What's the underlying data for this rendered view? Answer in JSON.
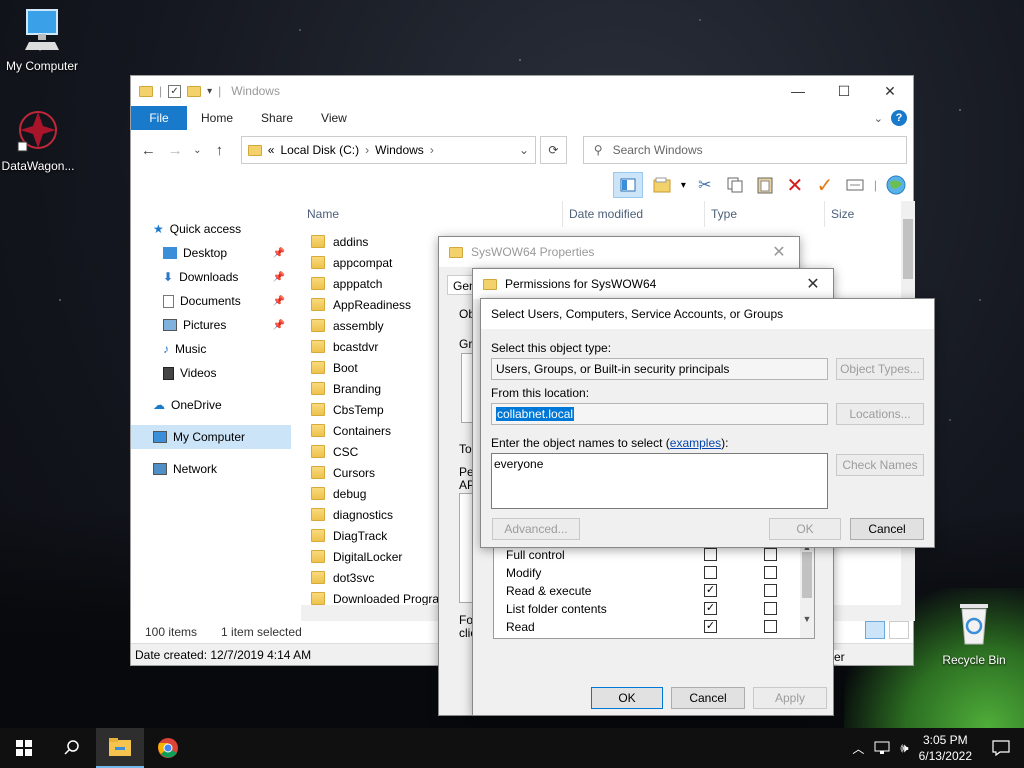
{
  "desktop": {
    "icons": [
      {
        "label": "My Computer"
      },
      {
        "label": "DataWagon..."
      },
      {
        "label": "Recycle Bin"
      }
    ]
  },
  "explorer": {
    "title": "Windows",
    "tabs": {
      "file": "File",
      "home": "Home",
      "share": "Share",
      "view": "View"
    },
    "help": "?",
    "address": {
      "prefix": "«",
      "seg1": "Local Disk (C:)",
      "seg2": "Windows"
    },
    "search_placeholder": "Search Windows",
    "sidebar": [
      {
        "label": "Quick access"
      },
      {
        "label": "Desktop"
      },
      {
        "label": "Downloads"
      },
      {
        "label": "Documents"
      },
      {
        "label": "Pictures"
      },
      {
        "label": "Music"
      },
      {
        "label": "Videos"
      },
      {
        "label": "OneDrive"
      },
      {
        "label": "My Computer"
      },
      {
        "label": "Network"
      }
    ],
    "columns": {
      "name": "Name",
      "date": "Date modified",
      "type": "Type",
      "size": "Size"
    },
    "files": [
      "addins",
      "appcompat",
      "apppatch",
      "AppReadiness",
      "assembly",
      "bcastdvr",
      "Boot",
      "Branding",
      "CbsTemp",
      "Containers",
      "CSC",
      "Cursors",
      "debug",
      "diagnostics",
      "DiagTrack",
      "DigitalLocker",
      "dot3svc",
      "Downloaded Program"
    ],
    "status": {
      "count": "100 items",
      "selected": "1 item selected"
    },
    "details": "Date created: 12/7/2019 4:14 AM"
  },
  "properties": {
    "title": "SysWOW64 Properties",
    "tab": "Gen",
    "fragments": {
      "ob": "Ob",
      "gr": "Gr",
      "to": "To",
      "pe": "Pe",
      "ap": "AP",
      "fo": "Fo",
      "cli": "clic"
    }
  },
  "permissions": {
    "title": "Permissions for SysWOW64",
    "rows": [
      {
        "label": "Full control",
        "allow": false,
        "deny": false
      },
      {
        "label": "Modify",
        "allow": false,
        "deny": false
      },
      {
        "label": "Read & execute",
        "allow": true,
        "deny": false
      },
      {
        "label": "List folder contents",
        "allow": true,
        "deny": false
      },
      {
        "label": "Read",
        "allow": true,
        "deny": false
      }
    ],
    "ok": "OK",
    "cancel": "Cancel",
    "apply": "Apply",
    "side_text": "er"
  },
  "select_dialog": {
    "title": "Select Users, Computers, Service Accounts, or Groups",
    "object_type_label": "Select this object type:",
    "object_type_value": "Users, Groups, or Built-in security principals",
    "object_types_btn": "Object Types...",
    "location_label": "From this location:",
    "location_value": "collabnet.local",
    "locations_btn": "Locations...",
    "names_label_pre": "Enter the object names to select (",
    "names_label_link": "examples",
    "names_label_post": "):",
    "names_value": "everyone",
    "check_names_btn": "Check Names",
    "advanced_btn": "Advanced...",
    "ok_btn": "OK",
    "cancel_btn": "Cancel"
  },
  "taskbar": {
    "time": "3:05 PM",
    "date": "6/13/2022"
  },
  "colors": {
    "accent": "#1979ca",
    "folder": "#f4d26b",
    "selection": "#cce4f7"
  }
}
